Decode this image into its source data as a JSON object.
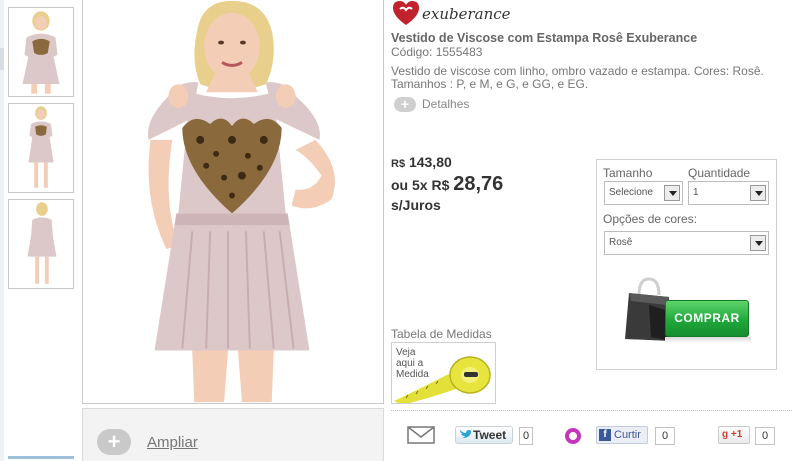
{
  "brand": {
    "logo_text": "exuberance",
    "heart_color": "#c0232c"
  },
  "product": {
    "title": "Vestido de Viscose com Estampa Rosê Exuberance",
    "code": "Código: 1555483",
    "description_line1": "Vestido de viscose com linho, ombro vazado e estampa. Cores: Rosê.",
    "description_line2": "Tamanhos : P, e M, e G, e GG, e EG.",
    "details_label": "Detalhes",
    "details_plus": "+"
  },
  "price": {
    "currency": "R$",
    "full": "143,80",
    "installment_prefix": "ou 5x R$",
    "installment_value": "28,76",
    "installment_suffix": "s/Juros"
  },
  "buy_box": {
    "size_label": "Tamanho",
    "size_value": "Selecione",
    "qty_label": "Quantidade",
    "qty_value": "1",
    "color_label": "Opções de cores:",
    "color_value": "Rosê",
    "buy_label": "COMPRAR",
    "buy_color": "#1fa83b"
  },
  "size_table": {
    "label": "Tabela de Medidas",
    "card_line1": "Veja",
    "card_line2": "aqui a",
    "card_line3": "Medida"
  },
  "gallery": {
    "zoom_plus": "+",
    "zoom_label": "Ampliar",
    "thumbnail_count": 3
  },
  "share": {
    "tweet_label": "Tweet",
    "tweet_count": "0",
    "fb_label": "Curtir",
    "fb_count": "0",
    "gplus_label": "+1",
    "gplus_g": "g",
    "gplus_count": "0"
  },
  "colors": {
    "dress": "#dcc8c9",
    "leopard": "#8a6a3c",
    "skin": "#f3cdb6",
    "hair": "#e8cf8c"
  }
}
